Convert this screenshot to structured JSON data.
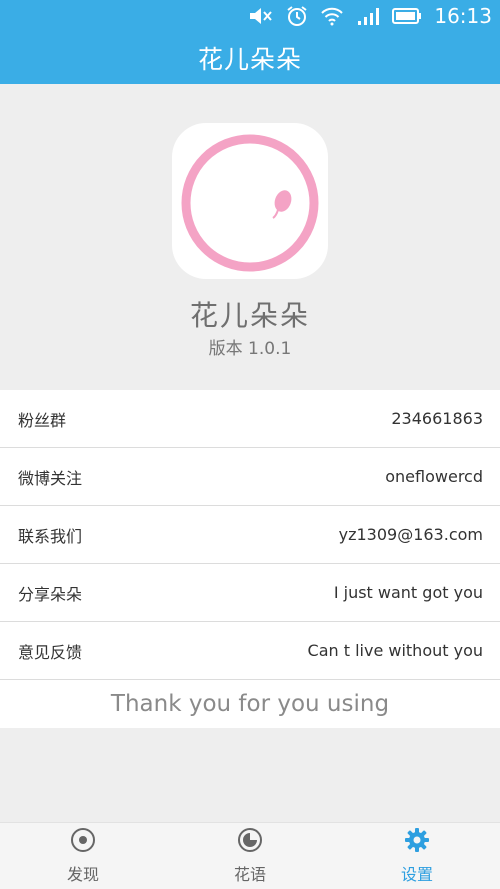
{
  "status_bar": {
    "time": "16:13",
    "icons": [
      "mute-icon",
      "alarm-icon",
      "wifi-icon",
      "signal-icon",
      "battery-icon"
    ]
  },
  "app_bar": {
    "title": "花儿朵朵"
  },
  "about": {
    "app_name": "花儿朵朵",
    "version": "版本 1.0.1"
  },
  "info_rows": [
    {
      "label": "粉丝群",
      "value": "234661863"
    },
    {
      "label": "微博关注",
      "value": "oneflowercd"
    },
    {
      "label": "联系我们",
      "value": "yz1309@163.com"
    },
    {
      "label": "分享朵朵",
      "value": "I just want got you"
    },
    {
      "label": "意见反馈",
      "value": "Can t live without you"
    }
  ],
  "thanks_text": "Thank you for you using",
  "bottom_nav": [
    {
      "label": "发现",
      "icon": "discover-icon",
      "active": false
    },
    {
      "label": "花语",
      "icon": "flower-language-icon",
      "active": false
    },
    {
      "label": "设置",
      "icon": "settings-icon",
      "active": true
    }
  ],
  "colors": {
    "primary": "#3aade6",
    "accent": "#2e9fe0",
    "logo_pink": "#f4a3c5"
  }
}
